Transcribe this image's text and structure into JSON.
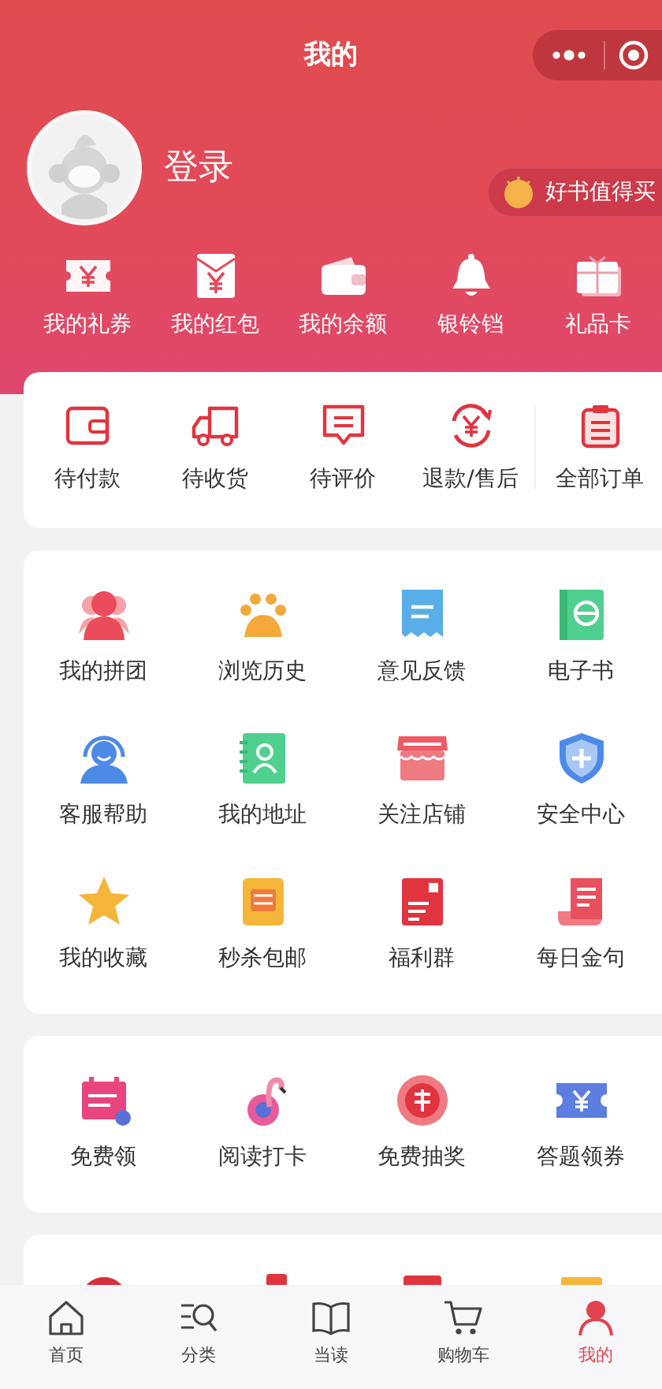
{
  "header": {
    "title": "我的"
  },
  "profile": {
    "login": "登录",
    "promo": "好书值得买"
  },
  "wallet": [
    {
      "label": "我的礼券"
    },
    {
      "label": "我的红包"
    },
    {
      "label": "我的余额"
    },
    {
      "label": "银铃铛"
    },
    {
      "label": "礼品卡"
    }
  ],
  "orders": [
    {
      "label": "待付款"
    },
    {
      "label": "待收货"
    },
    {
      "label": "待评价"
    },
    {
      "label": "退款/售后"
    },
    {
      "label": "全部订单"
    }
  ],
  "services": [
    {
      "label": "我的拼团"
    },
    {
      "label": "浏览历史"
    },
    {
      "label": "意见反馈"
    },
    {
      "label": "电子书"
    },
    {
      "label": "客服帮助"
    },
    {
      "label": "我的地址"
    },
    {
      "label": "关注店铺"
    },
    {
      "label": "安全中心"
    },
    {
      "label": "我的收藏"
    },
    {
      "label": "秒杀包邮"
    },
    {
      "label": "福利群"
    },
    {
      "label": "每日金句"
    }
  ],
  "activities": [
    {
      "label": "免费领"
    },
    {
      "label": "阅读打卡"
    },
    {
      "label": "免费抽奖"
    },
    {
      "label": "答题领券"
    }
  ],
  "tabs": [
    {
      "label": "首页",
      "selected": false
    },
    {
      "label": "分类",
      "selected": false
    },
    {
      "label": "当读",
      "selected": false
    },
    {
      "label": "购物车",
      "selected": false
    },
    {
      "label": "我的",
      "selected": true
    }
  ]
}
